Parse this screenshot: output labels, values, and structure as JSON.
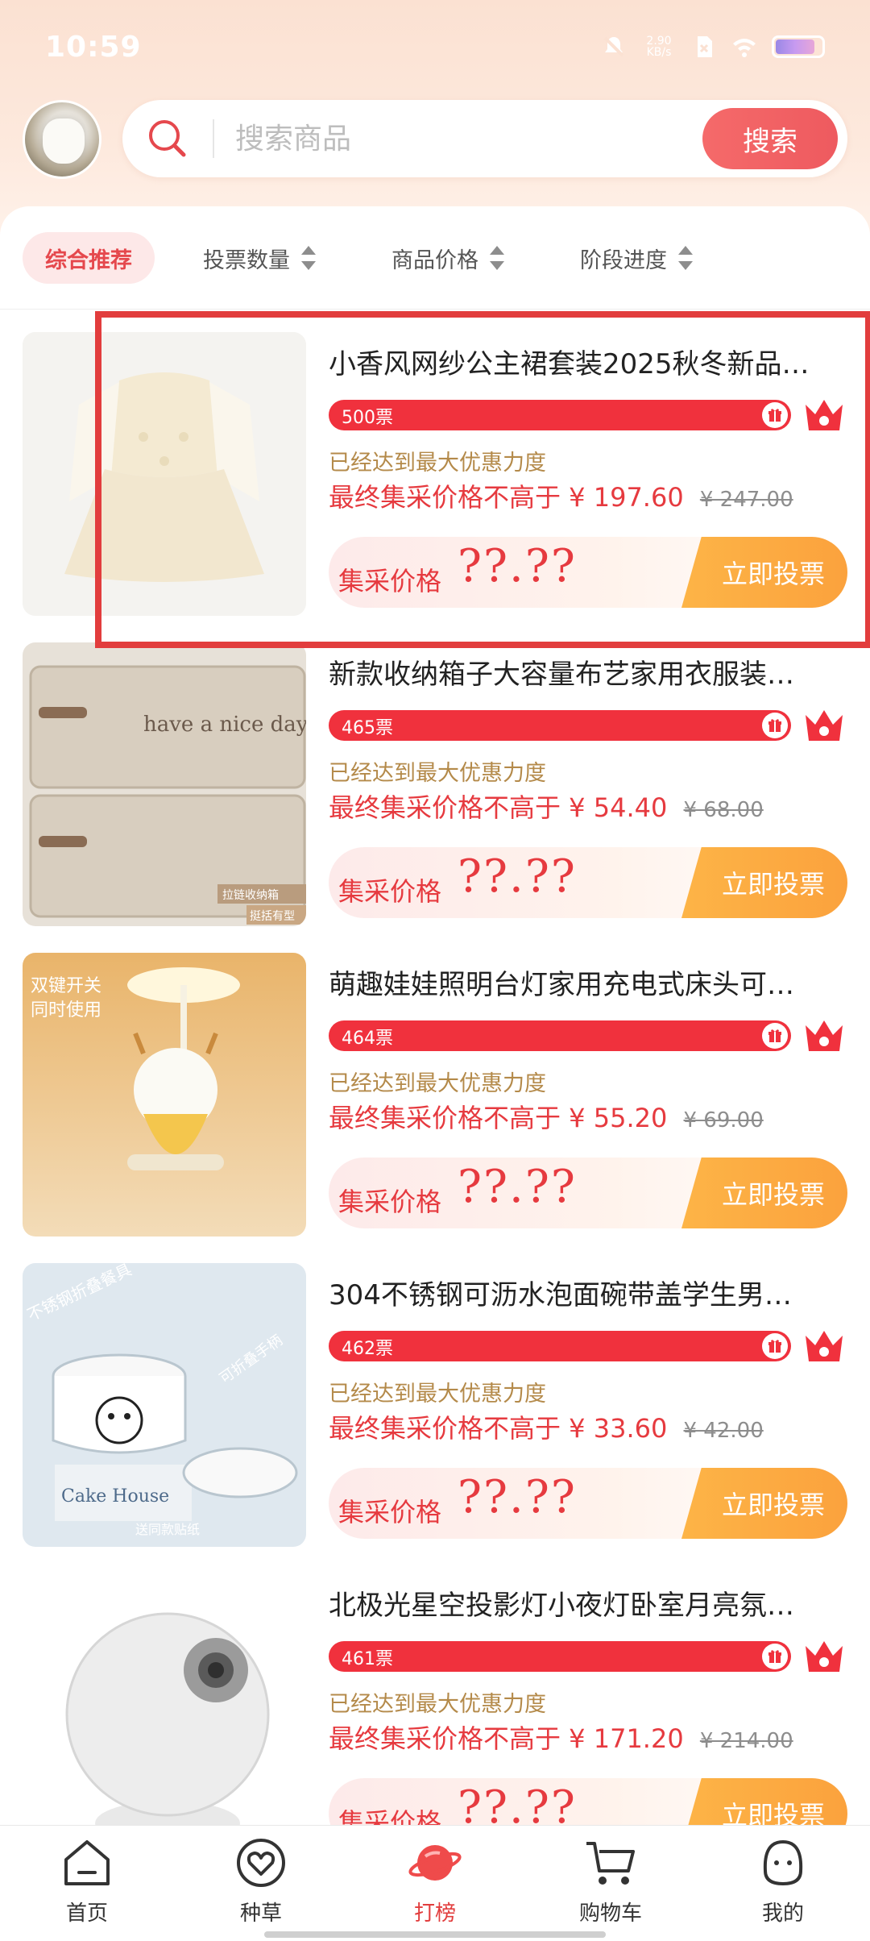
{
  "status_bar": {
    "time": "10:59",
    "speed_value": "2.90",
    "speed_unit": "KB/s"
  },
  "search": {
    "placeholder": "搜索商品",
    "button_label": "搜索"
  },
  "sort_tabs": [
    {
      "label": "综合推荐",
      "active": true
    },
    {
      "label": "投票数量",
      "active": false
    },
    {
      "label": "商品价格",
      "active": false
    },
    {
      "label": "阶段进度",
      "active": false
    }
  ],
  "common": {
    "max_discount_text": "已经达到最大优惠力度",
    "final_price_prefix": "最终集采价格不高于 ¥ ",
    "group_label": "集采价格",
    "group_price": "??.??",
    "vote_button": "立即投票"
  },
  "products": [
    {
      "title": "小香风网纱公主裙套装2025秋冬新品…",
      "votes": "500票",
      "final_price": "197.60",
      "original_price": "¥ 247.00"
    },
    {
      "title": "新款收纳箱子大容量布艺家用衣服装…",
      "votes": "465票",
      "final_price": "54.40",
      "original_price": "¥ 68.00",
      "image_text": [
        "have a nice day",
        "拉链收纳箱",
        "挺括有型"
      ]
    },
    {
      "title": "萌趣娃娃照明台灯家用充电式床头可…",
      "votes": "464票",
      "final_price": "55.20",
      "original_price": "¥ 69.00",
      "image_text": [
        "双键开关",
        "同时使用"
      ]
    },
    {
      "title": "304不锈钢可沥水泡面碗带盖学生男…",
      "votes": "462票",
      "final_price": "33.60",
      "original_price": "¥ 42.00",
      "image_text": [
        "不锈钢折叠餐具",
        "可折叠手柄",
        "Cake House",
        "送同款贴纸"
      ]
    },
    {
      "title": "北极光星空投影灯小夜灯卧室月亮氛…",
      "votes": "461票",
      "final_price": "171.20",
      "original_price": "¥ 214.00"
    }
  ],
  "bottom_nav": [
    {
      "label": "首页",
      "icon": "home-icon",
      "active": false
    },
    {
      "label": "种草",
      "icon": "heart-icon",
      "active": false
    },
    {
      "label": "打榜",
      "icon": "planet-icon",
      "active": true
    },
    {
      "label": "购物车",
      "icon": "cart-icon",
      "active": false
    },
    {
      "label": "我的",
      "icon": "profile-icon",
      "active": false
    }
  ],
  "colors": {
    "accent_red": "#e63a3f",
    "vote_bar": "#f0313d",
    "button_orange": "#fba23d",
    "highlight_border": "#e23d3d"
  }
}
